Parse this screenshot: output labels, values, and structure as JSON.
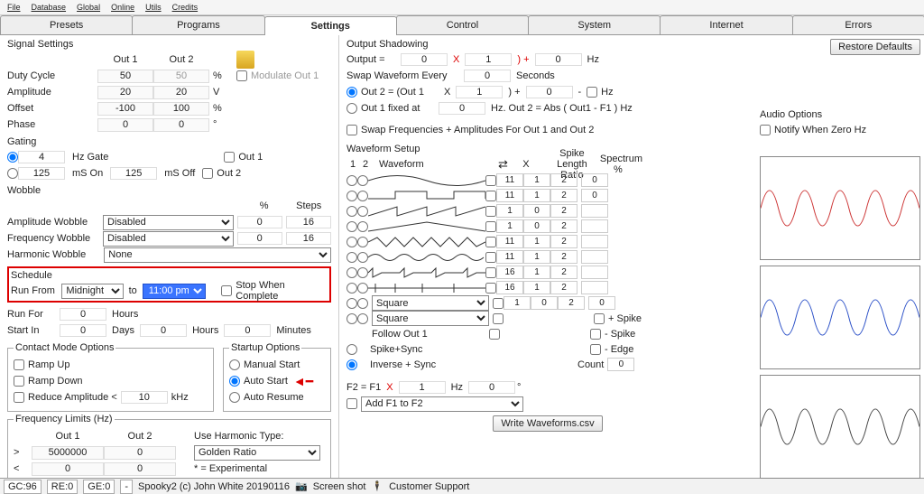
{
  "menu": [
    "File",
    "Database",
    "Global",
    "Online",
    "Utils",
    "Credits"
  ],
  "tabs": [
    "Presets",
    "Programs",
    "Settings",
    "Control",
    "System",
    "Internet",
    "Errors"
  ],
  "active_tab": "Settings",
  "signal": {
    "title": "Signal Settings",
    "cols": [
      "Out 1",
      "Out 2"
    ],
    "rows": [
      {
        "label": "Duty Cycle",
        "v1": "50",
        "v2": "50",
        "unit": "%"
      },
      {
        "label": "Amplitude",
        "v1": "20",
        "v2": "20",
        "unit": "V"
      },
      {
        "label": "Offset",
        "v1": "-100",
        "v2": "100",
        "unit": "%"
      },
      {
        "label": "Phase",
        "v1": "0",
        "v2": "0",
        "unit": "°"
      }
    ],
    "modulate": "Modulate Out 1"
  },
  "gating": {
    "title": "Gating",
    "hz": "4",
    "hzLabel": "Hz Gate",
    "mson": "125",
    "msonLabel": "mS On",
    "msoff": "125",
    "msoffLabel": "mS Off",
    "out1": "Out 1",
    "out2": "Out 2"
  },
  "wobble": {
    "title": "Wobble",
    "pct": "%",
    "steps": "Steps",
    "amp": "Amplitude Wobble",
    "ampVal": "Disabled",
    "ampPct": "0",
    "ampSt": "16",
    "freq": "Frequency Wobble",
    "freqVal": "Disabled",
    "freqPct": "0",
    "freqSt": "16",
    "harm": "Harmonic Wobble",
    "harmVal": "None"
  },
  "schedule": {
    "title": "Schedule",
    "runFrom": "Run From",
    "from": "Midnight",
    "to": "to",
    "until": "11:00 pm",
    "stop": "Stop When Complete",
    "runFor": "Run For",
    "rfv": "0",
    "hours": "Hours",
    "startIn": "Start In",
    "d": "0",
    "days": "Days",
    "h": "0",
    "hours2": "Hours",
    "m": "0",
    "minutes": "Minutes"
  },
  "contact": {
    "title": "Contact Mode Options",
    "rampUp": "Ramp Up",
    "rampDown": "Ramp Down",
    "reduce": "Reduce Amplitude <",
    "reduceVal": "10",
    "kHz": "kHz"
  },
  "startup": {
    "title": "Startup Options",
    "manual": "Manual Start",
    "auto": "Auto Start",
    "resume": "Auto Resume"
  },
  "freqlim": {
    "title": "Frequency Limits (Hz)",
    "out1": "Out 1",
    "out2": "Out 2",
    "gt": ">",
    "lt": "<",
    "o1gt": "5000000",
    "o1lt": "0",
    "o2gt": "0",
    "o2lt": "0",
    "harmType": "Use Harmonic Type:",
    "harmVal": "Golden Ratio",
    "exp": "* = Experimental"
  },
  "shadow": {
    "title": "Output Shadowing",
    "restore": "Restore Defaults",
    "outputEq": "Output =",
    "x": "X",
    "plus": ")   +",
    "hz": "Hz",
    "v1": "0",
    "v2": "1",
    "v3": "0",
    "swap": "Swap Waveform Every",
    "swapV": "0",
    "secs": "Seconds",
    "o2": "Out 2 = (Out 1",
    "o2x": "X",
    "o2v": "1",
    "o2p": ")   +",
    "o2p2": "0",
    "dash": "-",
    "hz2": "Hz",
    "o1f": "Out 1 fixed at",
    "o1fv": "0",
    "o1fend": "Hz. Out 2 = Abs ( Out1 - F1 ) Hz",
    "swapFA": "Swap Frequencies + Amplitudes For Out 1 and Out 2"
  },
  "wfs": {
    "title": "Waveform Setup",
    "c1": "1",
    "c2": "2",
    "wform": "Waveform",
    "x": "X",
    "spike": "Spike",
    "len": "Length Ratio",
    "pct": "%",
    "spec": "Spectrum",
    "rows": [
      {
        "x": "11",
        "l": "1",
        "r": "2",
        "p": "0"
      },
      {
        "x": "11",
        "l": "1",
        "r": "2",
        "p": "0"
      },
      {
        "x": "1",
        "l": "0",
        "r": "2",
        "p": ""
      },
      {
        "x": "1",
        "l": "0",
        "r": "2",
        "p": ""
      },
      {
        "x": "11",
        "l": "1",
        "r": "2",
        "p": ""
      },
      {
        "x": "11",
        "l": "1",
        "r": "2",
        "p": ""
      },
      {
        "x": "16",
        "l": "1",
        "r": "2",
        "p": ""
      },
      {
        "x": "16",
        "l": "1",
        "r": "2",
        "p": ""
      }
    ],
    "sq": "Square",
    "follow": "Follow Out 1",
    "spikesync": "Spike+Sync",
    "inverse": "Inverse + Sync",
    "pspike": "+ Spike",
    "mspike": "- Spike",
    "edge": "- Edge",
    "count": "Count",
    "countV": "0",
    "sqx": "1",
    "sql": "0",
    "sqr": "2",
    "sqp": "0",
    "f2": "F2 = F1",
    "f2x": "X",
    "f2v": "1",
    "f2hz": "Hz",
    "f2o": "0",
    "deg": "°",
    "addf": "Add F1 to F2",
    "write": "Write Waveforms.csv"
  },
  "audio": {
    "title": "Audio Options",
    "notify": "Notify When Zero Hz"
  },
  "status": {
    "gc": "GC:96",
    "re": "RE:0",
    "ge": "GE:0",
    "dash": "-",
    "copy": "Spooky2 (c) John White 20190116",
    "ss": "Screen shot",
    "cs": "Customer Support"
  },
  "spectrum_colors": [
    "#cc3333",
    "#2a4fc7",
    "#444444"
  ]
}
